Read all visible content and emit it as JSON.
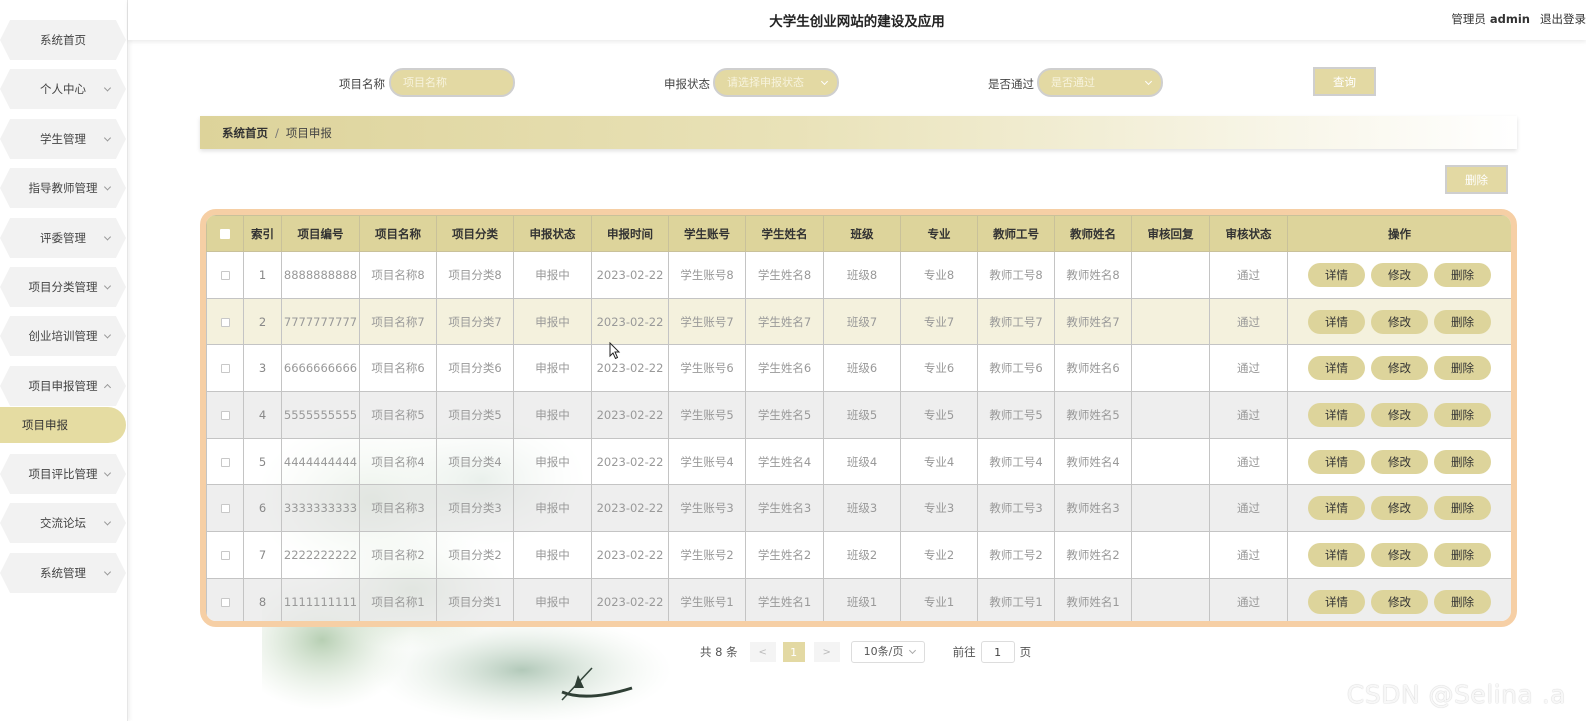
{
  "header": {
    "title": "大学生创业网站的建设及应用",
    "role": "管理员",
    "username": "admin",
    "logout": "退出登录"
  },
  "sidebar": {
    "items": [
      {
        "label": "系统首页",
        "arrow": "none"
      },
      {
        "label": "个人中心",
        "arrow": "down"
      },
      {
        "label": "学生管理",
        "arrow": "down"
      },
      {
        "label": "指导教师管理",
        "arrow": "down"
      },
      {
        "label": "评委管理",
        "arrow": "down"
      },
      {
        "label": "项目分类管理",
        "arrow": "down"
      },
      {
        "label": "创业培训管理",
        "arrow": "down"
      },
      {
        "label": "项目申报管理",
        "arrow": "up"
      },
      {
        "label": "项目申报",
        "arrow": "none",
        "active": true
      },
      {
        "label": "项目评比管理",
        "arrow": "down"
      },
      {
        "label": "交流论坛",
        "arrow": "down"
      },
      {
        "label": "系统管理",
        "arrow": "down"
      }
    ]
  },
  "search": {
    "name_label": "项目名称",
    "name_placeholder": "项目名称",
    "status_label": "申报状态",
    "status_placeholder": "请选择申报状态",
    "pass_label": "是否通过",
    "pass_placeholder": "是否通过",
    "query_button": "查询"
  },
  "breadcrumb": {
    "home": "系统首页",
    "separator": "/",
    "current": "项目申报"
  },
  "toolbar": {
    "delete_button": "删除"
  },
  "table": {
    "columns": [
      "索引",
      "项目编号",
      "项目名称",
      "项目分类",
      "申报状态",
      "申报时间",
      "学生账号",
      "学生姓名",
      "班级",
      "专业",
      "教师工号",
      "教师姓名",
      "审核回复",
      "审核状态",
      "操作"
    ],
    "actions": {
      "detail": "详情",
      "edit": "修改",
      "delete": "删除"
    },
    "rows": [
      {
        "index": "1",
        "code": "8888888888",
        "name": "项目名称8",
        "category": "项目分类8",
        "status": "申报中",
        "date": "2023-02-22",
        "account": "学生账号8",
        "student": "学生姓名8",
        "class": "班级8",
        "major": "专业8",
        "teacher_id": "教师工号8",
        "teacher": "教师姓名8",
        "reply": "",
        "review": "通过"
      },
      {
        "index": "2",
        "code": "7777777777",
        "name": "项目名称7",
        "category": "项目分类7",
        "status": "申报中",
        "date": "2023-02-22",
        "account": "学生账号7",
        "student": "学生姓名7",
        "class": "班级7",
        "major": "专业7",
        "teacher_id": "教师工号7",
        "teacher": "教师姓名7",
        "reply": "",
        "review": "通过"
      },
      {
        "index": "3",
        "code": "6666666666",
        "name": "项目名称6",
        "category": "项目分类6",
        "status": "申报中",
        "date": "2023-02-22",
        "account": "学生账号6",
        "student": "学生姓名6",
        "class": "班级6",
        "major": "专业6",
        "teacher_id": "教师工号6",
        "teacher": "教师姓名6",
        "reply": "",
        "review": "通过"
      },
      {
        "index": "4",
        "code": "5555555555",
        "name": "项目名称5",
        "category": "项目分类5",
        "status": "申报中",
        "date": "2023-02-22",
        "account": "学生账号5",
        "student": "学生姓名5",
        "class": "班级5",
        "major": "专业5",
        "teacher_id": "教师工号5",
        "teacher": "教师姓名5",
        "reply": "",
        "review": "通过"
      },
      {
        "index": "5",
        "code": "4444444444",
        "name": "项目名称4",
        "category": "项目分类4",
        "status": "申报中",
        "date": "2023-02-22",
        "account": "学生账号4",
        "student": "学生姓名4",
        "class": "班级4",
        "major": "专业4",
        "teacher_id": "教师工号4",
        "teacher": "教师姓名4",
        "reply": "",
        "review": "通过"
      },
      {
        "index": "6",
        "code": "3333333333",
        "name": "项目名称3",
        "category": "项目分类3",
        "status": "申报中",
        "date": "2023-02-22",
        "account": "学生账号3",
        "student": "学生姓名3",
        "class": "班级3",
        "major": "专业3",
        "teacher_id": "教师工号3",
        "teacher": "教师姓名3",
        "reply": "",
        "review": "通过"
      },
      {
        "index": "7",
        "code": "2222222222",
        "name": "项目名称2",
        "category": "项目分类2",
        "status": "申报中",
        "date": "2023-02-22",
        "account": "学生账号2",
        "student": "学生姓名2",
        "class": "班级2",
        "major": "专业2",
        "teacher_id": "教师工号2",
        "teacher": "教师姓名2",
        "reply": "",
        "review": "通过"
      },
      {
        "index": "8",
        "code": "1111111111",
        "name": "项目名称1",
        "category": "项目分类1",
        "status": "申报中",
        "date": "2023-02-22",
        "account": "学生账号1",
        "student": "学生姓名1",
        "class": "班级1",
        "major": "专业1",
        "teacher_id": "教师工号1",
        "teacher": "教师姓名1",
        "reply": "",
        "review": "通过"
      }
    ]
  },
  "pagination": {
    "total": "共 8 条",
    "prev": "<",
    "page": "1",
    "next": ">",
    "page_size": "10条/页",
    "goto_label": "前往",
    "goto_value": "1",
    "goto_suffix": "页"
  },
  "watermark": "CSDN @Selina .a",
  "colors": {
    "accent": "#ddd49b",
    "table_border": "#f6cfa5",
    "active_menu": "#e5dca2"
  }
}
